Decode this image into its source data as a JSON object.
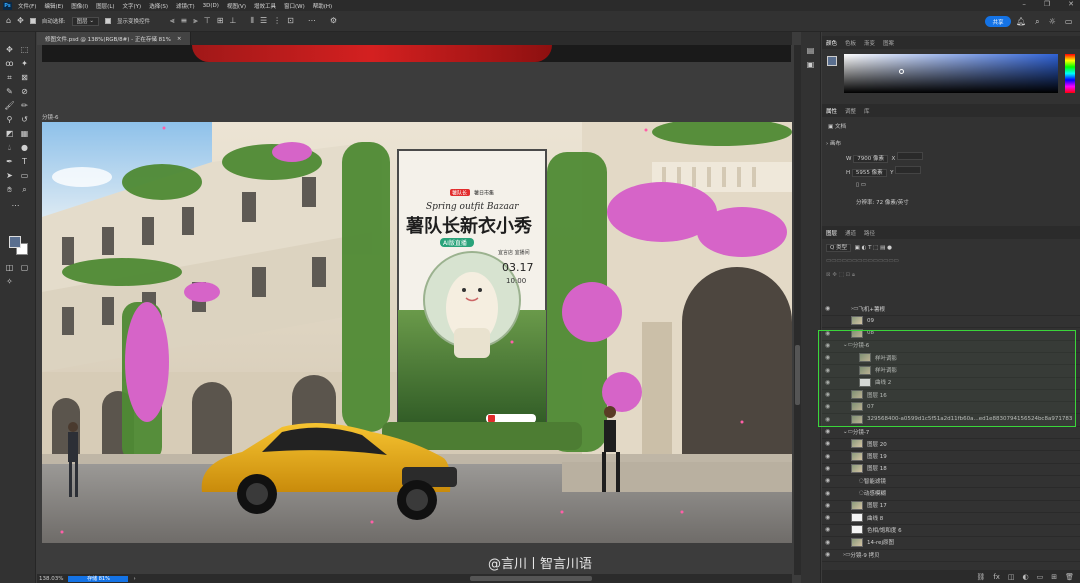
{
  "app": {
    "logo": "Ps"
  },
  "menu": [
    "文件(F)",
    "编辑(E)",
    "图像(I)",
    "图层(L)",
    "文字(Y)",
    "选择(S)",
    "滤镜(T)",
    "3D(D)",
    "视图(V)",
    "增效工具",
    "窗口(W)",
    "帮助(H)"
  ],
  "window_controls": [
    "–",
    "❐",
    "✕"
  ],
  "options": {
    "auto_select_label": "自动选择:",
    "auto_select_value": "图层",
    "transform_label": "显示变换控件",
    "share_label": "共享"
  },
  "document": {
    "tab_title": "修图文件.psd @ 138%(RGB/8#) - 正在存储 81%",
    "close": "×",
    "artboard_label": "分镜-6"
  },
  "status": {
    "zoom": "138.03%",
    "progress_label": "存储 81%"
  },
  "watermark": "@言川丨智言川语",
  "poster": {
    "badge": "薯队长",
    "top_line": "薯日市集",
    "subtitle": "Spring outfit Bazaar",
    "title": "薯队长新衣小秀",
    "tag": "AI版直播",
    "place": "宜言店 宜播间",
    "date": "03.17",
    "time": "10:00"
  },
  "color_panel": {
    "tabs": [
      "颜色",
      "色板",
      "渐变",
      "图案"
    ],
    "active": 0
  },
  "properties_panel": {
    "tabs": [
      "属性",
      "调整",
      "库"
    ],
    "active": 0,
    "doc_label": "文档",
    "canvas_label": "画布",
    "w_label": "W",
    "w_value": "7900 像素",
    "h_label": "H",
    "h_value": "5955 像素",
    "x_label": "X",
    "y_label": "Y",
    "resolution": "分辨率: 72 像素/英寸"
  },
  "layers_panel": {
    "tabs": [
      "图层",
      "通道",
      "路径"
    ],
    "active": 0,
    "filter_label": "Q 类型",
    "layers": [
      {
        "name": "飞机+薯根",
        "type": "group",
        "visible": true,
        "indent": 1
      },
      {
        "name": "09",
        "type": "layer",
        "visible": false,
        "indent": 1
      },
      {
        "name": "08",
        "type": "layer",
        "visible": true,
        "indent": 1
      },
      {
        "name": "分镜-6",
        "type": "group-open",
        "visible": true,
        "indent": 0
      },
      {
        "name": "样叶调影",
        "type": "layer",
        "visible": true,
        "indent": 2
      },
      {
        "name": "样叶调影",
        "type": "layer",
        "visible": true,
        "indent": 2
      },
      {
        "name": "曲线 2",
        "type": "adjust",
        "visible": true,
        "indent": 2
      },
      {
        "name": "图层 16",
        "type": "layer",
        "visible": true,
        "indent": 1
      },
      {
        "name": "07",
        "type": "layer",
        "visible": true,
        "indent": 1
      },
      {
        "name": "329568400-a0599d1c5f51a2d11fb60a...ed1e8830794156524bc8a9717835276b",
        "type": "layer",
        "visible": true,
        "indent": 1
      },
      {
        "name": "分镜-7",
        "type": "group-open",
        "visible": true,
        "indent": 0
      },
      {
        "name": "图层 20",
        "type": "layer",
        "visible": true,
        "indent": 1
      },
      {
        "name": "图层 19",
        "type": "layer",
        "visible": true,
        "indent": 1
      },
      {
        "name": "图层 18",
        "type": "layer",
        "visible": true,
        "indent": 1
      },
      {
        "name": "智能滤镜",
        "type": "fx",
        "visible": true,
        "indent": 2
      },
      {
        "name": "动感模糊",
        "type": "fx",
        "visible": true,
        "indent": 2
      },
      {
        "name": "图层 17",
        "type": "layer",
        "visible": true,
        "indent": 1
      },
      {
        "name": "曲线 8",
        "type": "adjust",
        "visible": true,
        "indent": 1
      },
      {
        "name": "色相/饱和度 6",
        "type": "adjust",
        "visible": true,
        "indent": 1
      },
      {
        "name": "14-rej原图",
        "type": "layer",
        "visible": true,
        "indent": 1
      },
      {
        "name": "分镜-9 拷贝",
        "type": "group",
        "visible": true,
        "indent": 0
      }
    ]
  },
  "colors": {
    "accent": "#1473e6",
    "selection": "#3ad63a"
  }
}
